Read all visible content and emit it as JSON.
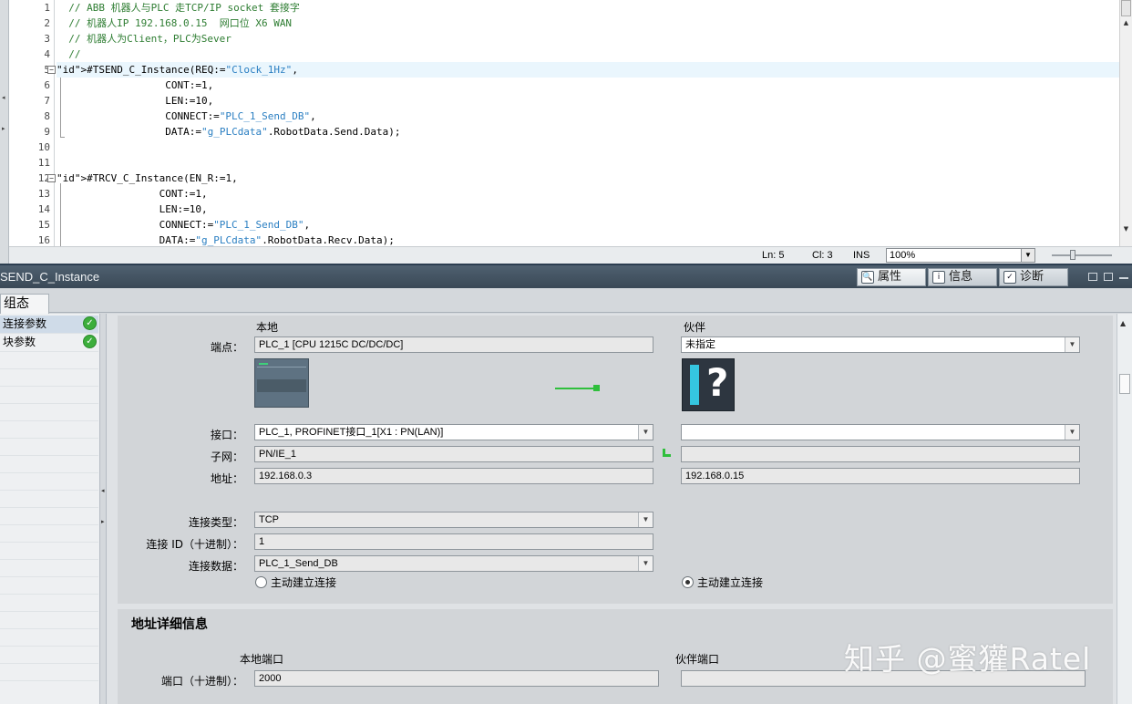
{
  "editor": {
    "lines": [
      {
        "no": "1",
        "code": "// ABB 机器人与PLC 走TCP/IP socket 套接字"
      },
      {
        "no": "2",
        "code": "// 机器人IP 192.168.0.15  网口位 X6 WAN"
      },
      {
        "no": "3",
        "code": "// 机器人为Client，PLC为Sever"
      },
      {
        "no": "4",
        "code": "//"
      },
      {
        "no": "5",
        "code": "#TSEND_C_Instance(REQ:=\"Clock_1Hz\","
      },
      {
        "no": "6",
        "code": "                  CONT:=1,"
      },
      {
        "no": "7",
        "code": "                  LEN:=10,"
      },
      {
        "no": "8",
        "code": "                  CONNECT:=\"PLC_1_Send_DB\","
      },
      {
        "no": "9",
        "code": "                  DATA:=\"g_PLCdata\".RobotData.Send.Data);"
      },
      {
        "no": "10",
        "code": ""
      },
      {
        "no": "11",
        "code": ""
      },
      {
        "no": "12",
        "code": "#TRCV_C_Instance(EN_R:=1,"
      },
      {
        "no": "13",
        "code": "                 CONT:=1,"
      },
      {
        "no": "14",
        "code": "                 LEN:=10,"
      },
      {
        "no": "15",
        "code": "                 CONNECT:=\"PLC_1_Send_DB\","
      },
      {
        "no": "16",
        "code": "                 DATA:=\"g_PLCdata\".RobotData.Recv.Data);"
      }
    ],
    "status": {
      "ln": "Ln: 5",
      "cl": "Cl: 3",
      "ins": "INS",
      "zoom": "100%"
    }
  },
  "inspector": {
    "title": "SEND_C_Instance",
    "tabs": {
      "properties": "属性",
      "info": "信息",
      "diagnostics": "诊断"
    },
    "config_tab": "组态",
    "nav": [
      "连接参数",
      "块参数"
    ],
    "headers": {
      "local": "本地",
      "partner": "伙伴"
    },
    "labels": {
      "endpoint": "端点：",
      "interface": "接口：",
      "subnet": "子网：",
      "address": "地址：",
      "conn_type": "连接类型：",
      "conn_id": "连接 ID（十进制）：",
      "conn_data": "连接数据：",
      "port": "端口（十进制）："
    },
    "local": {
      "endpoint": "PLC_1 [CPU 1215C DC/DC/DC]",
      "interface": "PLC_1, PROFINET接口_1[X1 : PN(LAN)]",
      "subnet": "PN/IE_1",
      "address": "192.168.0.3",
      "conn_type": "TCP",
      "conn_id": "1",
      "conn_data": "PLC_1_Send_DB",
      "active": "主动建立连接"
    },
    "partner": {
      "endpoint": "未指定",
      "interface": "",
      "subnet": "",
      "address": "192.168.0.15",
      "active": "主动建立连接"
    },
    "address_detail": {
      "title": "地址详细信息",
      "local_port_hdr": "本地端口",
      "partner_port_hdr": "伙伴端口",
      "local_port": "2000",
      "partner_port": ""
    }
  },
  "watermark": "知乎 @蜜獾Ratel",
  "colors": {
    "ok": "#3cae3c",
    "link": "#2fbf3c",
    "titlebar": "#3a4957"
  }
}
